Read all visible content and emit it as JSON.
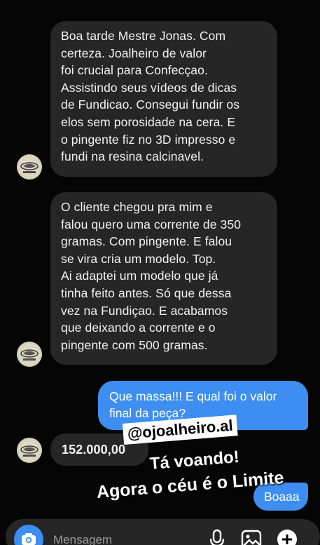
{
  "messages": {
    "incoming_1": "Boa tarde Mestre Jonas.  Com\ncerteza.  Joalheiro de valor\nfoi crucial para Confecçao.\nAssistindo seus vídeos de dicas\nde Fundicao. Consegui fundir os\nelos sem porosidade na cera.  E\no pingente fiz no 3D impresso e\nfundi na resina calcinavel.",
    "incoming_2": "O cliente chegou pra mim e\nfalou quero uma corrente de 350\ngramas. Com pingente.  E falou\nse vira cria um modelo. Top.\nAi adaptei um modelo que já\ntinha feito antes.  Só que dessa\nvez na Fundiçao. E acabamos\nque deixando a corrente e o\npingente com 500 gramas.",
    "outgoing_1": "Que massa!!! E qual foi o valor\nfinal da peça?",
    "incoming_3": "152.000,00",
    "outgoing_2": "Boaaa"
  },
  "overlay": {
    "handle": "@ojoalheiro.al",
    "line1": "Tá voando!",
    "line2": "Agora o céu é o Limite"
  },
  "composer": {
    "placeholder": "Mensagem"
  },
  "icons": {
    "camera": "camera-icon",
    "microphone": "microphone-icon",
    "gallery": "image-gallery-icon",
    "add": "plus-icon",
    "avatar": "sender-avatar"
  },
  "colors": {
    "background": "#050505",
    "incoming_bubble": "#262626",
    "outgoing_bubble": "#3d8ef0",
    "overlay_tag_bg": "#ffffff"
  }
}
